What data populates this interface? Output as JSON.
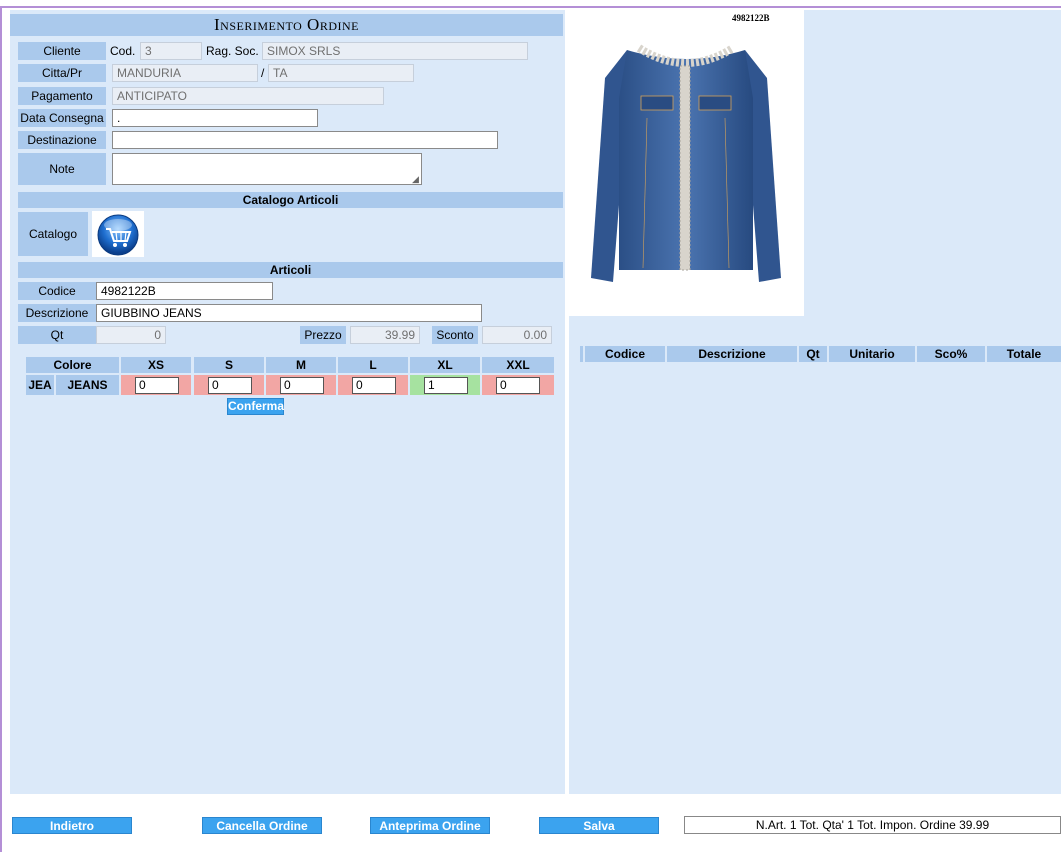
{
  "form": {
    "title": "Inserimento Ordine",
    "cliente_label": "Cliente",
    "cod_label": "Cod.",
    "cod_value": "3",
    "ragsoc_label": "Rag. Soc.",
    "ragsoc_value": "SIMOX SRLS",
    "citta_label": "Citta/Pr",
    "citta_value": "MANDURIA",
    "slash": "/",
    "provincia_value": "TA",
    "pagamento_label": "Pagamento",
    "pagamento_value": "ANTICIPATO",
    "data_consegna_label": "Data Consegna",
    "data_consegna_value": ".",
    "destinazione_label": "Destinazione",
    "destinazione_value": "",
    "note_label": "Note",
    "note_value": ""
  },
  "catalogo": {
    "section_title": "Catalogo Articoli",
    "label": "Catalogo",
    "icon": "shopping-cart-icon"
  },
  "articoli": {
    "section_title": "Articoli",
    "codice_label": "Codice",
    "codice_value": "4982122B",
    "descrizione_label": "Descrizione",
    "descrizione_value": "GIUBBINO JEANS",
    "qt_label": "Qt",
    "qt_value": "0",
    "prezzo_label": "Prezzo",
    "prezzo_value": "39.99",
    "sconto_label": "Sconto",
    "sconto_value": "0.00"
  },
  "sizes": {
    "colore_label": "Colore",
    "headers": [
      "XS",
      "S",
      "M",
      "L",
      "XL",
      "XXL"
    ],
    "color_code": "JEA",
    "color_name": "JEANS",
    "values": [
      "0",
      "0",
      "0",
      "0",
      "1",
      "0"
    ],
    "confirm_label": "Conferma"
  },
  "product": {
    "code_caption": "4982122B",
    "image_icon": "denim-jacket-image"
  },
  "order_table": {
    "headers": [
      "Codice",
      "Descrizione",
      "Qt",
      "Unitario",
      "Sco%",
      "Totale"
    ]
  },
  "footer": {
    "back_label": "Indietro",
    "cancel_label": "Cancella Ordine",
    "preview_label": "Anteprima Ordine",
    "save_label": "Salva",
    "summary": "N.Art. 1  Tot. Qta' 1   Tot. Impon. Ordine 39.99"
  },
  "colors": {
    "panel": "#dbe9f9",
    "label_bg": "#aac9ec",
    "button": "#3ba3ef",
    "size_red": "#f2a6a4",
    "size_green": "#a6e2a0",
    "frame": "#b48fd6"
  }
}
